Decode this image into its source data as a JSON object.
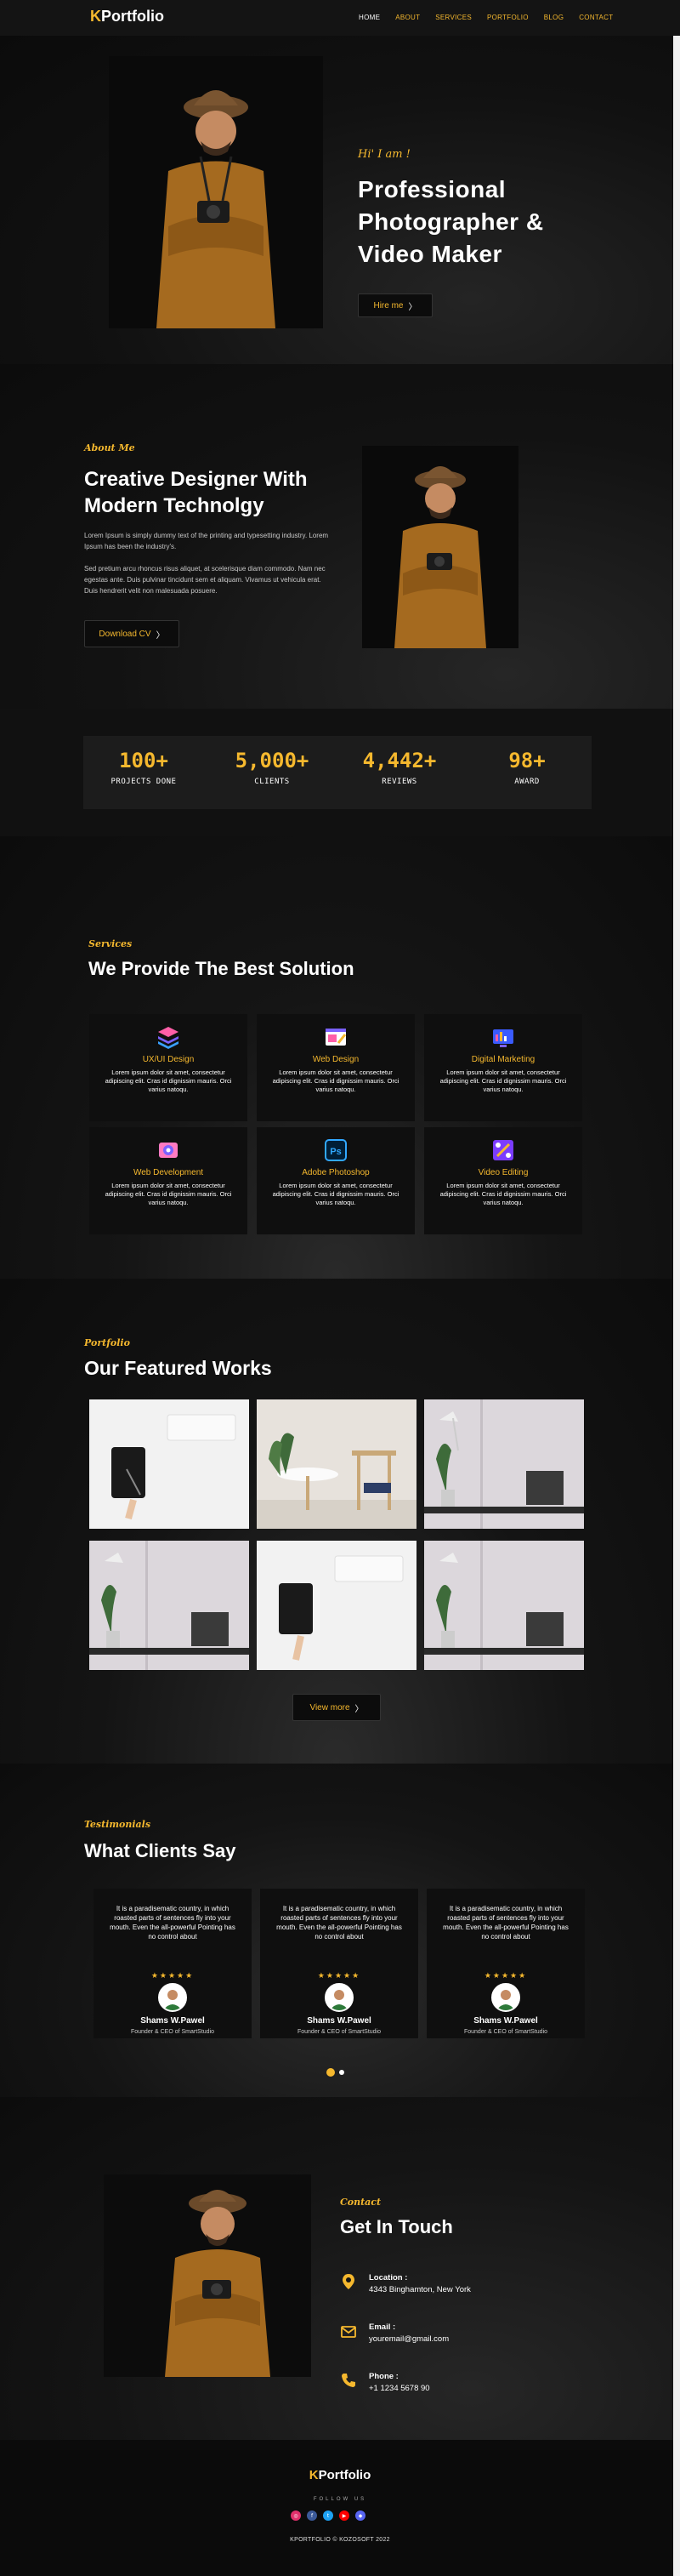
{
  "nav": {
    "logo_k": "K",
    "logo_rest": "Portfolio",
    "items": [
      "HOME",
      "ABOUT",
      "SERVICES",
      "PORTFOLIO",
      "BLOG",
      "CONTACT"
    ],
    "active": "HOME"
  },
  "hero": {
    "greeting": "Hi' I am !",
    "title": "Professional Photographer & Video Maker",
    "button": "Hire me",
    "photo_alt": "photographer-with-hat-and-camera"
  },
  "about": {
    "label": "About Me",
    "title_line1": "Creative Designer With",
    "title_line2": "Modern Technolgy",
    "para1": "Lorem Ipsum is simply dummy text of the printing and typesetting industry. Lorem Ipsum has been the industry's.",
    "para2": "Sed pretium arcu rhoncus risus aliquet, at scelerisque diam commodo. Nam nec egestas ante. Duis pulvinar tincidunt sem et aliquam. Vivamus ut vehicula erat. Duis hendrerit velit non malesuada posuere.",
    "button": "Download CV"
  },
  "counters": [
    {
      "num": "100+",
      "label": "PROJECTS DONE"
    },
    {
      "num": "5,000+",
      "label": "CLIENTS"
    },
    {
      "num": "4,442+",
      "label": "REVIEWS"
    },
    {
      "num": "98+",
      "label": "AWARD"
    }
  ],
  "services": {
    "label": "Services",
    "title": "We Provide The Best Solution",
    "items": [
      {
        "title": "UX/UI Design",
        "text": "Lorem ipsum dolor sit amet, consectetur adipiscing elit. Cras id dignissim mauris. Orci varius natoqu.",
        "icon": "layers-icon"
      },
      {
        "title": "Web Design",
        "text": "Lorem ipsum dolor sit amet, consectetur adipiscing elit. Cras id dignissim mauris. Orci varius natoqu.",
        "icon": "web-design-icon"
      },
      {
        "title": "Digital Marketing",
        "text": "Lorem ipsum dolor sit amet, consectetur adipiscing elit. Cras id dignissim mauris. Orci varius natoqu.",
        "icon": "marketing-icon"
      },
      {
        "title": "Web Development",
        "text": "Lorem ipsum dolor sit amet, consectetur adipiscing elit. Cras id dignissim mauris. Orci varius natoqu.",
        "icon": "web-development-icon"
      },
      {
        "title": "Adobe Photoshop",
        "text": "Lorem ipsum dolor sit amet, consectetur adipiscing elit. Cras id dignissim mauris. Orci varius natoqu.",
        "icon": "photoshop-icon"
      },
      {
        "title": "Video Editing",
        "text": "Lorem ipsum dolor sit amet, consectetur adipiscing elit. Cras id dignissim mauris. Orci varius natoqu.",
        "icon": "video-editing-icon"
      }
    ]
  },
  "portfolio": {
    "label": "Portfolio",
    "title": "Our Featured Works",
    "button": "View more",
    "works": [
      "tablet-and-keyboard",
      "table-and-chair",
      "desk-lamp-and-plant",
      "desk-lamp-and-plant",
      "tablet-and-keyboard",
      "desk-lamp-and-plant"
    ]
  },
  "testimonials": {
    "label": "Testimonials",
    "title": "What Clients Say",
    "items": [
      {
        "quote": "It is a paradisematic country, in which roasted parts of sentences fly into your mouth. Even the all-powerful Pointing has no control about",
        "name": "Shams W.Pawel",
        "role": "Founder & CEO of SmartStudio"
      },
      {
        "quote": "It is a paradisematic country, in which roasted parts of sentences fly into your mouth. Even the all-powerful Pointing has no control about",
        "name": "Shams W.Pawel",
        "role": "Founder & CEO of SmartStudio"
      },
      {
        "quote": "It is a paradisematic country, in which roasted parts of sentences fly into your mouth. Even the all-powerful Pointing has no control about",
        "name": "Shams W.Pawel",
        "role": "Founder & CEO of SmartStudio"
      }
    ],
    "stars": "★★★★★"
  },
  "contact": {
    "label": "Contact",
    "title": "Get In Touch",
    "items": [
      {
        "label": "Location :",
        "value": "4343 Binghamton, New York",
        "icon": "location-pin-icon"
      },
      {
        "label": "Email :",
        "value": "youremail@gmail.com",
        "icon": "envelope-icon"
      },
      {
        "label": "Phone :",
        "value": "+1 1234 5678 90",
        "icon": "phone-icon"
      }
    ]
  },
  "footer": {
    "logo_k": "K",
    "logo_rest": "Portfolio",
    "follow": "FOLLOW US",
    "socials": [
      {
        "name": "instagram-icon",
        "glyph": "◎",
        "color": "#e1306c"
      },
      {
        "name": "facebook-icon",
        "glyph": "f",
        "color": "#3b5998"
      },
      {
        "name": "twitter-icon",
        "glyph": "t",
        "color": "#1da1f2"
      },
      {
        "name": "youtube-icon",
        "glyph": "▶",
        "color": "#ff0000"
      },
      {
        "name": "discord-icon",
        "glyph": "◆",
        "color": "#5865f2"
      }
    ],
    "copyright": "KPORTFOLIO © KOZOSOFT 2022"
  },
  "colors": {
    "accent": "#f5b82e",
    "background": "#0d0d0d",
    "card": "#0f0f0f"
  }
}
